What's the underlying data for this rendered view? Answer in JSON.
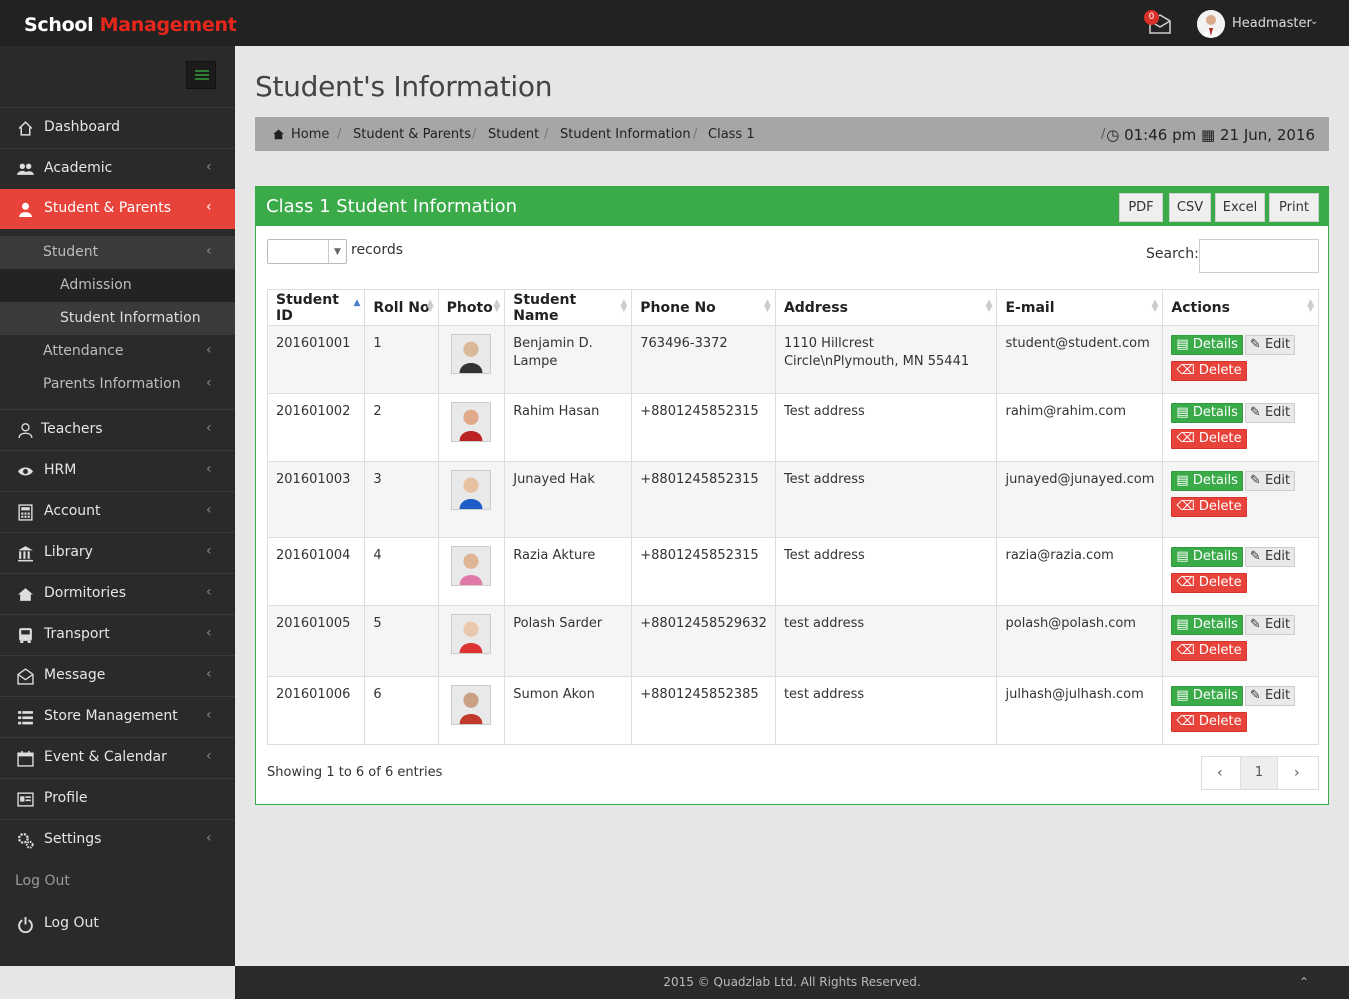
{
  "brand": {
    "part1": "School",
    "part2": "Management"
  },
  "header": {
    "mail_count": "0",
    "user_name": "Headmaster"
  },
  "sidebar": {
    "items": [
      {
        "label": "Dashboard",
        "icon": "home-icon"
      },
      {
        "label": "Academic",
        "icon": "users-icon"
      },
      {
        "label": "Student & Parents",
        "icon": "user-icon"
      },
      {
        "label": "Teachers",
        "icon": "teacher-icon"
      },
      {
        "label": "HRM",
        "icon": "eye-icon"
      },
      {
        "label": "Account",
        "icon": "calculator-icon"
      },
      {
        "label": "Library",
        "icon": "bank-icon"
      },
      {
        "label": "Dormitories",
        "icon": "home-icon"
      },
      {
        "label": "Transport",
        "icon": "bus-icon"
      },
      {
        "label": "Message",
        "icon": "envelope-icon"
      },
      {
        "label": "Store Management",
        "icon": "list-icon"
      },
      {
        "label": "Event & Calendar",
        "icon": "calendar-icon"
      },
      {
        "label": "Profile",
        "icon": "profile-icon"
      },
      {
        "label": "Settings",
        "icon": "cogs-icon"
      }
    ],
    "sub_student": "Student",
    "sub_admission": "Admission",
    "sub_student_info": "Student Information",
    "sub_attendance": "Attendance",
    "sub_parents": "Parents Information",
    "logout_plain": "Log Out",
    "logout": "Log Out"
  },
  "page": {
    "title": "Student's Information"
  },
  "breadcrumb": {
    "items": [
      "Home",
      "Student & Parents",
      "Student",
      "Student Information",
      "Class 1"
    ],
    "time": "01:46 pm",
    "date": "21 Jun, 2016"
  },
  "panel": {
    "title": "Class 1 Student Information",
    "export_buttons": [
      "PDF",
      "CSV",
      "Excel",
      "Print"
    ],
    "records_label": "records",
    "search_label": "Search:"
  },
  "table": {
    "headers": [
      "Student ID",
      "Roll No",
      "Photo",
      "Student Name",
      "Phone No",
      "Address",
      "E-mail",
      "Actions"
    ],
    "rows": [
      {
        "id": "201601001",
        "roll": "1",
        "name": "Benjamin D. Lampe",
        "phone": "763496-3372",
        "address": "1110 Hillcrest Circle\\nPlymouth, MN 55441",
        "email": "student@student.com"
      },
      {
        "id": "201601002",
        "roll": "2",
        "name": "Rahim Hasan",
        "phone": "+8801245852315",
        "address": "Test address",
        "email": "rahim@rahim.com"
      },
      {
        "id": "201601003",
        "roll": "3",
        "name": "Junayed Hak",
        "phone": "+8801245852315",
        "address": "Test address",
        "email": "junayed@junayed.com"
      },
      {
        "id": "201601004",
        "roll": "4",
        "name": "Razia Akture",
        "phone": "+8801245852315",
        "address": "Test address",
        "email": "razia@razia.com"
      },
      {
        "id": "201601005",
        "roll": "5",
        "name": "Polash Sarder",
        "phone": "+88012458529632",
        "address": "test address",
        "email": "polash@polash.com"
      },
      {
        "id": "201601006",
        "roll": "6",
        "name": "Sumon Akon",
        "phone": "+8801245852385",
        "address": "test address",
        "email": "julhash@julhash.com"
      }
    ],
    "actions": {
      "details": "Details",
      "edit": "Edit",
      "delete": "Delete"
    }
  },
  "pagination": {
    "info": "Showing 1 to 6 of 6 entries",
    "current": "1"
  },
  "footer": {
    "text": "2015 © Quadzlab Ltd. All Rights Reserved."
  },
  "colors": {
    "accent_red": "#e8433a",
    "panel_green": "#3bab4a",
    "sidebar": "#2a2a2a",
    "topbar": "#222222"
  }
}
